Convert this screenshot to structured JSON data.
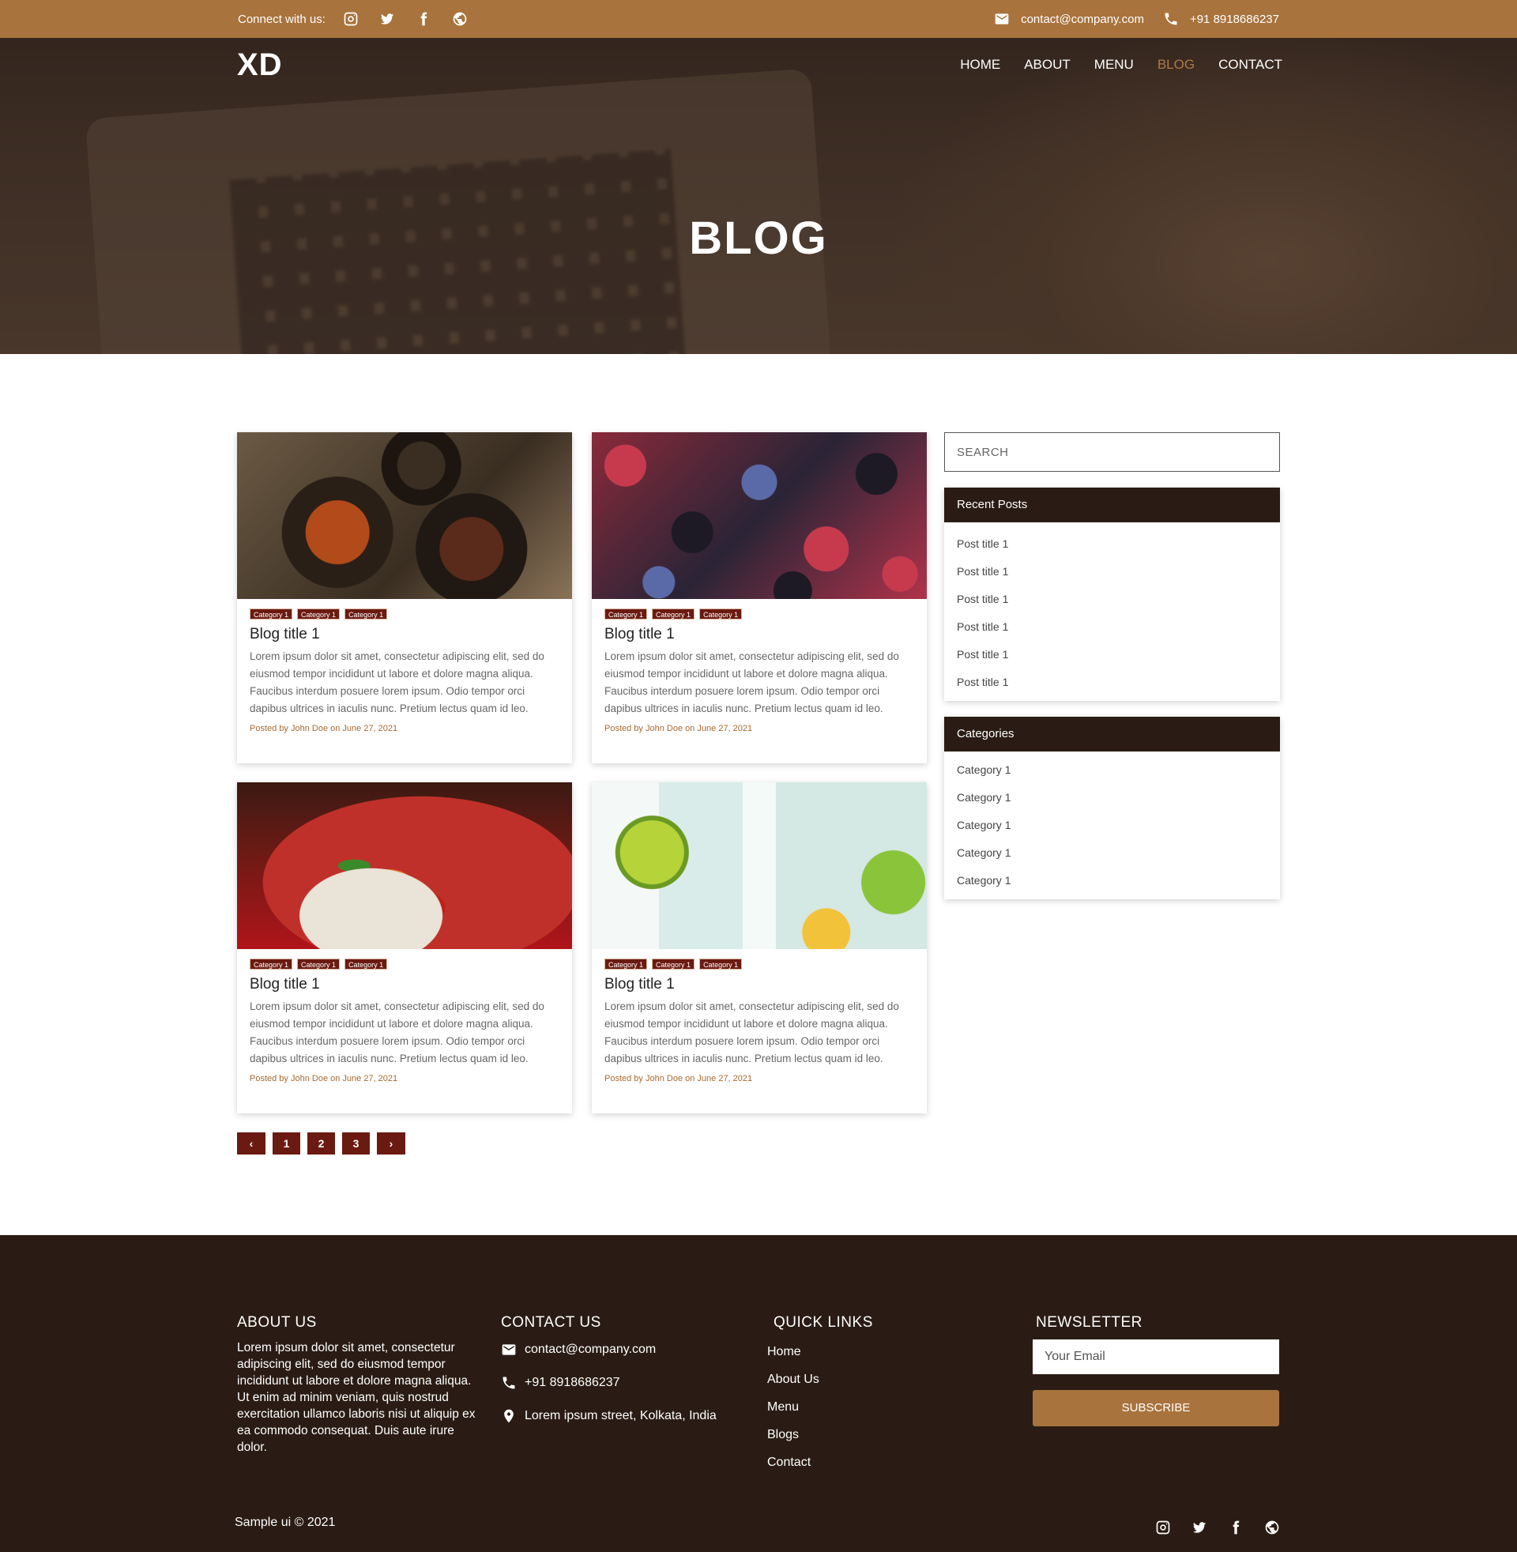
{
  "topbar": {
    "connect_label": "Connect with us:",
    "email": "contact@company.com",
    "phone": "+91 8918686237",
    "socials": [
      "instagram-icon",
      "twitter-icon",
      "facebook-icon",
      "globe-icon"
    ]
  },
  "nav": {
    "logo": "XD",
    "items": [
      {
        "label": "HOME",
        "active": false
      },
      {
        "label": "ABOUT",
        "active": false
      },
      {
        "label": "MENU",
        "active": false
      },
      {
        "label": "BLOG",
        "active": true
      },
      {
        "label": "CONTACT",
        "active": false
      }
    ]
  },
  "hero": {
    "title": "BLOG"
  },
  "posts": [
    {
      "image": "spices-image",
      "tags": [
        "Category 1",
        "Category 1",
        "Category 1"
      ],
      "title": "Blog title 1",
      "excerpt": "Lorem ipsum dolor sit amet, consectetur adipiscing elit, sed do eiusmod tempor incididunt ut labore et dolore magna aliqua. Faucibus interdum posuere lorem ipsum. Odio tempor orci dapibus ultrices in iaculis nunc. Pretium lectus quam id leo.",
      "meta": "Posted by John Doe on June 27, 2021"
    },
    {
      "image": "berries-image",
      "tags": [
        "Category 1",
        "Category 1",
        "Category 1"
      ],
      "title": "Blog title 1",
      "excerpt": "Lorem ipsum dolor sit amet, consectetur adipiscing elit, sed do eiusmod tempor incididunt ut labore et dolore magna aliqua. Faucibus interdum posuere lorem ipsum. Odio tempor orci dapibus ultrices in iaculis nunc. Pretium lectus quam id leo.",
      "meta": "Posted by John Doe on June 27, 2021"
    },
    {
      "image": "noodles-image",
      "tags": [
        "Category 1",
        "Category 1",
        "Category 1"
      ],
      "title": "Blog title 1",
      "excerpt": "Lorem ipsum dolor sit amet, consectetur adipiscing elit, sed do eiusmod tempor incididunt ut labore et dolore magna aliqua. Faucibus interdum posuere lorem ipsum. Odio tempor orci dapibus ultrices in iaculis nunc. Pretium lectus quam id leo.",
      "meta": "Posted by John Doe on June 27, 2021"
    },
    {
      "image": "mojito-image",
      "tags": [
        "Category 1",
        "Category 1",
        "Category 1"
      ],
      "title": "Blog title 1",
      "excerpt": "Lorem ipsum dolor sit amet, consectetur adipiscing elit, sed do eiusmod tempor incididunt ut labore et dolore magna aliqua. Faucibus interdum posuere lorem ipsum. Odio tempor orci dapibus ultrices in iaculis nunc. Pretium lectus quam id leo.",
      "meta": "Posted by John Doe on June 27, 2021"
    }
  ],
  "pagination": {
    "prev": "‹",
    "pages": [
      "1",
      "2",
      "3"
    ],
    "next": "›"
  },
  "sidebar": {
    "search_placeholder": "SEARCH",
    "recent_title": "Recent Posts",
    "recent_posts": [
      "Post title 1",
      "Post title 1",
      "Post title 1",
      "Post title 1",
      "Post title 1",
      "Post title 1"
    ],
    "categories_title": "Categories",
    "categories": [
      "Category 1",
      "Category 1",
      "Category 1",
      "Category 1",
      "Category 1"
    ]
  },
  "footer": {
    "about_title": "ABOUT US",
    "about_text": "Lorem ipsum dolor sit amet, consectetur adipiscing elit, sed do eiusmod tempor incididunt ut labore et dolore magna aliqua. Ut enim ad minim veniam, quis nostrud exercitation ullamco laboris nisi ut aliquip ex ea commodo consequat. Duis aute irure dolor.",
    "contact_title": "CONTACT US",
    "contact_email": "contact@company.com",
    "contact_phone": "+91 8918686237",
    "contact_address": "Lorem ipsum street, Kolkata, India",
    "links_title": "QUICK LINKS",
    "links": [
      "Home",
      "About Us",
      "Menu",
      "Blogs",
      "Contact"
    ],
    "newsletter_title": "NEWSLETTER",
    "email_placeholder": "Your Email",
    "subscribe_label": "SUBSCRIBE",
    "copyright": "Sample ui © 2021"
  },
  "colors": {
    "accent": "#a8733c",
    "dark": "#2a1c14",
    "tag": "#6b1a12",
    "active_nav": "#b07a45"
  }
}
